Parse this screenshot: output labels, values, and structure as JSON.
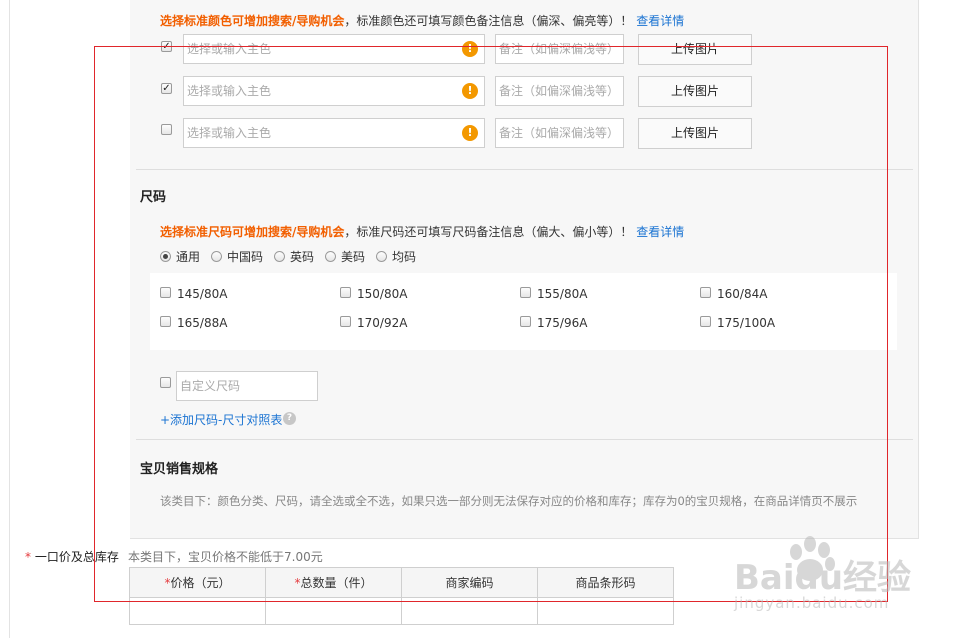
{
  "colors": {
    "accent_orange": "#f25f00",
    "link_blue": "#1a73d2",
    "warn_orange": "#f39800",
    "required_red": "#e4393c",
    "annotation_red": "#e0262b"
  },
  "color_section": {
    "tip_bold": "选择标准颜色可增加搜索/导购机会",
    "tip_rest": "，标准颜色还可填写颜色备注信息（偏深、偏亮等）！",
    "detail_link": "查看详情",
    "rows": [
      {
        "checked": true,
        "color_placeholder": "选择或输入主色",
        "note_placeholder": "备注（如偏深偏浅等）",
        "upload_label": "上传图片",
        "warn_icon": "exclamation-icon"
      },
      {
        "checked": true,
        "color_placeholder": "选择或输入主色",
        "note_placeholder": "备注（如偏深偏浅等）",
        "upload_label": "上传图片",
        "warn_icon": "exclamation-icon"
      },
      {
        "checked": false,
        "color_placeholder": "选择或输入主色",
        "note_placeholder": "备注（如偏深偏浅等）",
        "upload_label": "上传图片",
        "warn_icon": "exclamation-icon"
      }
    ]
  },
  "size_section": {
    "title": "尺码",
    "tip_bold": "选择标准尺码可增加搜索/导购机会",
    "tip_rest": "，标准尺码还可填写尺码备注信息（偏大、偏小等）！",
    "detail_link": "查看详情",
    "radios": [
      {
        "label": "通用",
        "selected": true
      },
      {
        "label": "中国码",
        "selected": false
      },
      {
        "label": "英码",
        "selected": false
      },
      {
        "label": "美码",
        "selected": false
      },
      {
        "label": "均码",
        "selected": false
      }
    ],
    "sizes": [
      "145/80A",
      "150/80A",
      "155/80A",
      "160/84A",
      "165/88A",
      "170/92A",
      "175/96A",
      "175/100A"
    ],
    "custom_placeholder": "自定义尺码",
    "add_link": "+添加尺码-尺寸对照表",
    "help_icon": "question-icon"
  },
  "sales_spec": {
    "title": "宝贝销售规格",
    "note": "该类目下：颜色分类、尺码，请全选或全不选，如果只选一部分则无法保存对应的价格和库存；库存为0的宝贝规格，在商品详情页不展示"
  },
  "price_stock": {
    "required_mark": "*",
    "label": "一口价及总库存",
    "hint": "本类目下，宝贝价格不能低于7.00元",
    "columns": [
      {
        "required": true,
        "label": "价格（元）"
      },
      {
        "required": true,
        "label": "总数量（件）"
      },
      {
        "required": false,
        "label": "商家编码"
      },
      {
        "required": false,
        "label": "商品条形码"
      }
    ],
    "row": [
      "",
      "",
      "",
      ""
    ]
  },
  "watermark": {
    "brand": "Baidu经验",
    "url": "jingyan.baidu.com"
  }
}
